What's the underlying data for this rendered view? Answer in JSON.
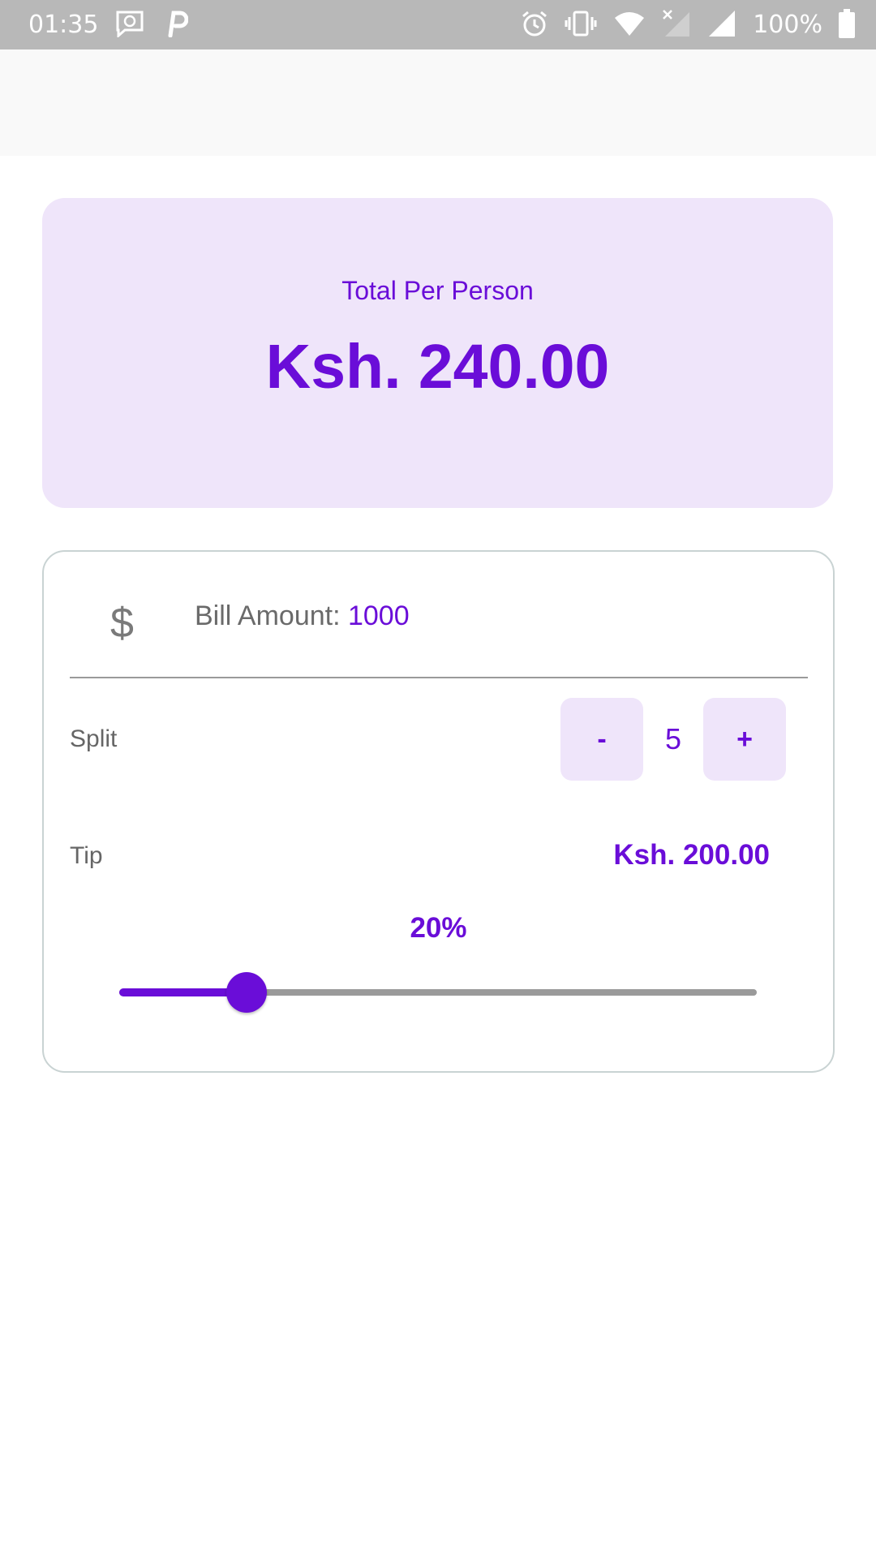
{
  "status_bar": {
    "time": "01:35",
    "battery": "100%",
    "icons": [
      "message-icon",
      "parking-icon",
      "alarm-icon",
      "vibrate-icon",
      "wifi-icon",
      "signal-off-icon",
      "signal-icon",
      "battery-icon"
    ]
  },
  "summary": {
    "label": "Total Per Person",
    "value": "Ksh. 240.00"
  },
  "bill": {
    "label": "Bill Amount: ",
    "value": "1000"
  },
  "split": {
    "label": "Split",
    "minus_label": "-",
    "count": "5",
    "plus_label": "+"
  },
  "tip": {
    "label": "Tip",
    "amount": "Ksh. 200.00",
    "percent_label": "20%",
    "slider_fraction": 0.2
  },
  "colors": {
    "accent": "#6a0dd8",
    "card_background": "#efe5fa",
    "status_bar": "#b8b8b8"
  }
}
